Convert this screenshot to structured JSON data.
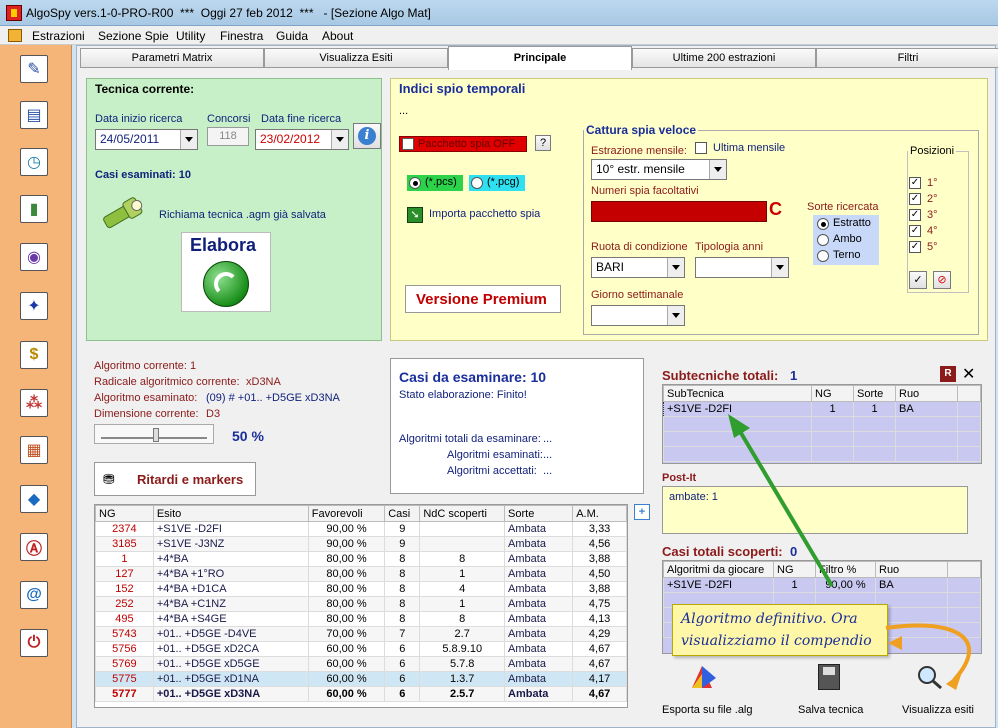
{
  "title_bar": {
    "title": "AlgoSpy vers.1-0-PRO-R00  ***  Oggi 27 feb 2012  ***   - [Sezione Algo Mat]"
  },
  "menu": [
    {
      "label": "Estrazioni"
    },
    {
      "label": "Sezione Spie"
    },
    {
      "label": "Utility"
    },
    {
      "label": "Finestra"
    },
    {
      "label": "Guida"
    },
    {
      "label": "About"
    }
  ],
  "tabs": [
    {
      "label": "Parametri Matrix"
    },
    {
      "label": "Visualizza Esiti"
    },
    {
      "label": "Principale"
    },
    {
      "label": "Ultime 200 estrazioni"
    },
    {
      "label": "Filtri"
    }
  ],
  "tecnica": {
    "heading": "Tecnica corrente:",
    "data_inizio_label": "Data inizio ricerca",
    "data_inizio": "24/05/2011",
    "concorsi_label": "Concorsi",
    "concorsi": "118",
    "data_fine_label": "Data fine ricerca",
    "data_fine": "23/02/2012",
    "casi_esaminati": "Casi esaminati: 10",
    "richiama": "Richiama tecnica .agm già salvata",
    "elabora": "Elabora"
  },
  "indici": {
    "heading": "Indici spio temporali",
    "dots": "...",
    "pacchetto": "Pacchetto spia OFF",
    "help": "?",
    "pcs": "(*.pcs)",
    "pcg": "(*.pcg)",
    "importa": "Importa pacchetto spia",
    "premium": "Versione Premium"
  },
  "cattura": {
    "heading": "Cattura spia veloce",
    "estrazione_label": "Estrazione mensile:",
    "ultima_mensile": "Ultima mensile",
    "estrazione_value": "10° estr. mensile",
    "numeri_label": "Numeri spia facoltativi",
    "c_mark": "C",
    "ruota_label": "Ruota di condizione",
    "ruota_value": "BARI",
    "tipologia_label": "Tipologia anni",
    "giorno_label": "Giorno settimanale",
    "sorte_label": "Sorte ricercata",
    "sorte_options": [
      "Estratto",
      "Ambo",
      "Terno"
    ],
    "posizioni_label": "Posizioni",
    "posizioni": [
      "1°",
      "2°",
      "3°",
      "4°",
      "5°"
    ]
  },
  "algoritmo": {
    "corrente": "Algoritmo corrente: 1",
    "radicale_label": "Radicale algoritmico corrente:",
    "radicale": "xD3NA",
    "esaminato_label": "Algoritmo esaminato:",
    "esaminato": "(09) # +01.. +D5GE xD3NA",
    "dimensione_label": "Dimensione corrente:",
    "dimensione": "D3",
    "percent": "50 %",
    "ritardi": "Ritardi e markers"
  },
  "casi_panel": {
    "title": "Casi da esaminare: 10",
    "stato": "Stato elaborazione: Finito!",
    "totali": "Algoritmi totali da esaminare:",
    "esaminati": "Algoritmi esaminati:",
    "accettati": "Algoritmi accettati:",
    "ellipsis": "..."
  },
  "results": {
    "columns": [
      "NG",
      "Esito",
      "Favorevoli",
      "Casi",
      "NdC scoperti",
      "Sorte",
      "A.M."
    ],
    "rows": [
      [
        "2374",
        "+S1VE -D2FI",
        "90,00 %",
        "9",
        "",
        "Ambata",
        "3,33"
      ],
      [
        "3185",
        "+S1VE -J3NZ",
        "90,00 %",
        "9",
        "",
        "Ambata",
        "4,56"
      ],
      [
        "1",
        "+4*BA",
        "80,00 %",
        "8",
        "8",
        "Ambata",
        "3,88"
      ],
      [
        "127",
        "+4*BA +1°RO",
        "80,00 %",
        "8",
        "1",
        "Ambata",
        "4,50"
      ],
      [
        "152",
        "+4*BA +D1CA",
        "80,00 %",
        "8",
        "4",
        "Ambata",
        "3,88"
      ],
      [
        "252",
        "+4*BA +C1NZ",
        "80,00 %",
        "8",
        "1",
        "Ambata",
        "4,75"
      ],
      [
        "495",
        "+4*BA +S4GE",
        "80,00 %",
        "8",
        "8",
        "Ambata",
        "4,13"
      ],
      [
        "5743",
        "+01.. +D5GE -D4VE",
        "70,00 %",
        "7",
        "2.7",
        "Ambata",
        "4,29"
      ],
      [
        "5756",
        "+01.. +D5GE xD2CA",
        "60,00 %",
        "6",
        "5.8.9.10",
        "Ambata",
        "4,67"
      ],
      [
        "5769",
        "+01.. +D5GE xD5GE",
        "60,00 %",
        "6",
        "5.7.8",
        "Ambata",
        "4,67"
      ],
      [
        "5775",
        "+01.. +D5GE xD1NA",
        "60,00 %",
        "6",
        "1.3.7",
        "Ambata",
        "4,17"
      ],
      [
        "5777",
        "+01.. +D5GE xD3NA",
        "60,00 %",
        "6",
        "2.5.7",
        "Ambata",
        "4,67"
      ]
    ]
  },
  "subtecniche": {
    "title": "Subtecniche totali:",
    "count": "1",
    "columns": [
      "SubTecnica",
      "NG",
      "Sorte",
      "Ruo"
    ],
    "rows": [
      [
        "+S1VE -D2FI",
        "1",
        "1",
        "BA"
      ]
    ]
  },
  "postit": {
    "title": "Post-It",
    "text": "ambate: 1"
  },
  "casi_totali": {
    "title": "Casi totali scoperti:",
    "count": "0",
    "columns": [
      "Algoritmi da giocare",
      "NG",
      "Filtro %",
      "Ruo"
    ],
    "rows": [
      [
        "+S1VE -D2FI",
        "1",
        "90,00 %",
        "BA"
      ]
    ]
  },
  "callout": {
    "line1": "Algoritmo definitivo. Ora",
    "line2": "visualizziamo il compendio"
  },
  "bottom_buttons": [
    {
      "label": "Esporta su file .alg"
    },
    {
      "label": "Salva tecnica"
    },
    {
      "label": "Visualizza esiti"
    }
  ],
  "colors": {
    "accent_green": "#2f9e2f",
    "red_field": "#c40000",
    "callout_bg": "#fff7a8"
  }
}
